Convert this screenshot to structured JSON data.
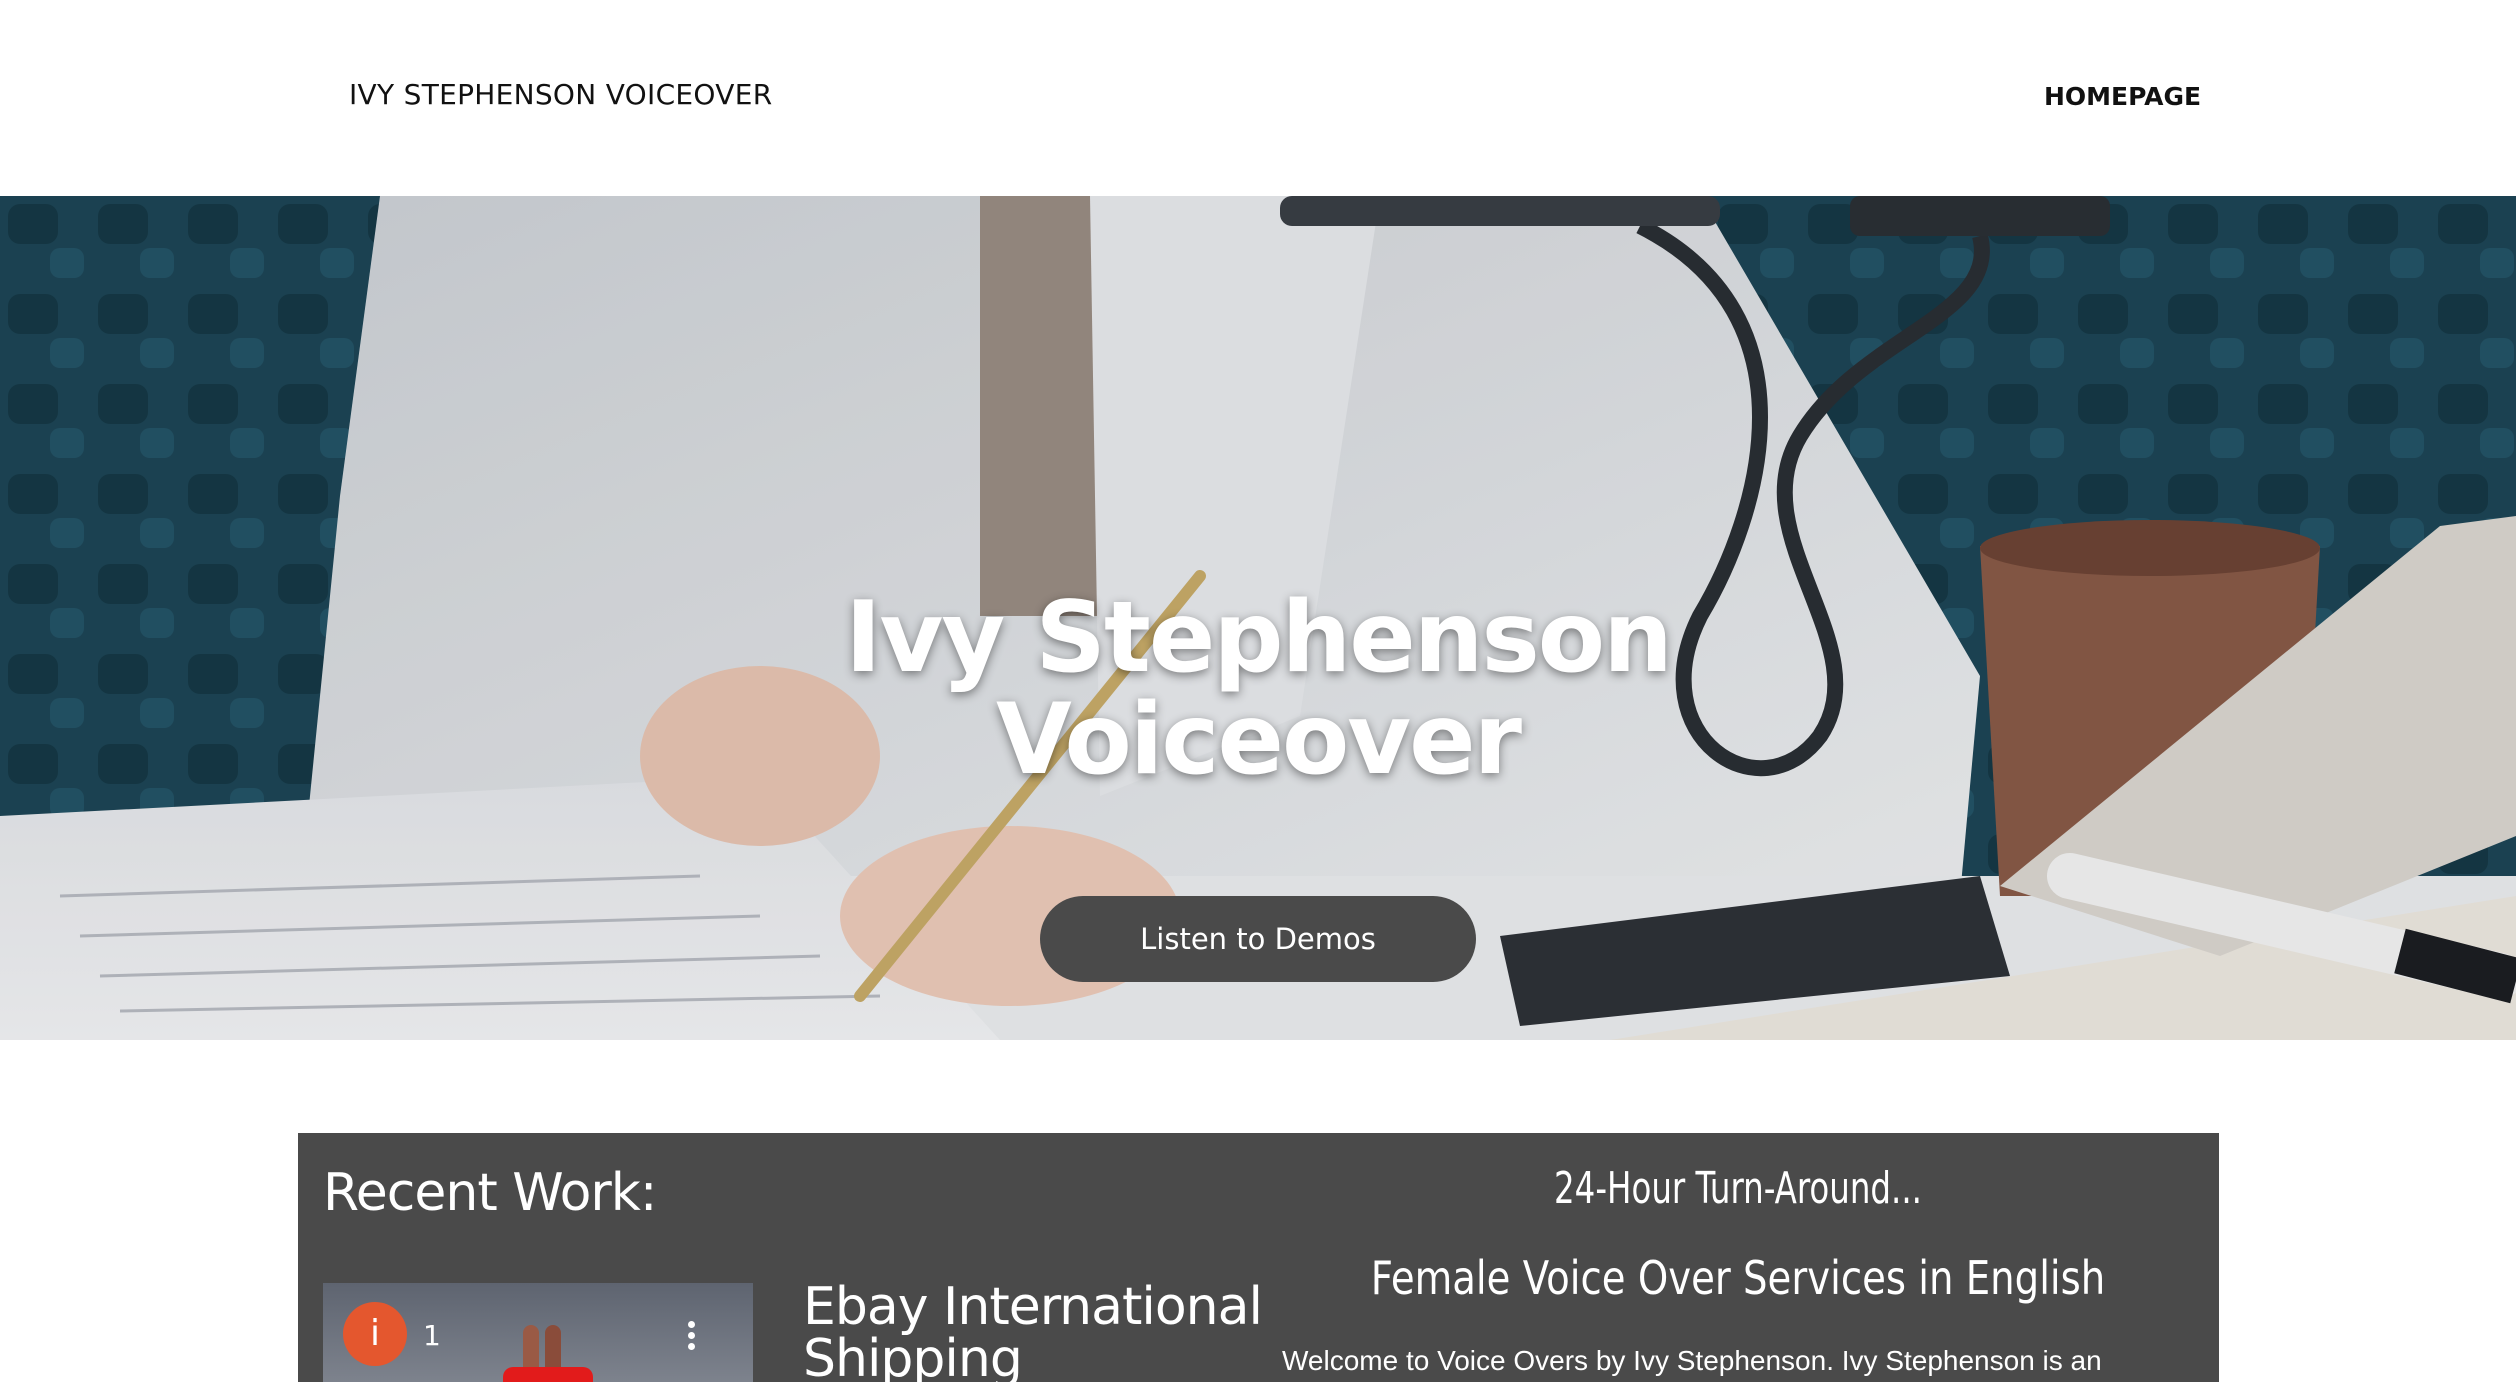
{
  "header": {
    "site_title": "IVY STEPHENSON VOICEOVER",
    "nav": {
      "home_label": "HOMEPAGE"
    }
  },
  "hero": {
    "title_line1": "Ivy Stephenson",
    "title_line2": "Voiceover",
    "cta_label": "Listen to Demos"
  },
  "recent_work": {
    "heading": "Recent Work:",
    "video": {
      "badge": "i",
      "count": "1",
      "title_line1": "Ebay International",
      "title_line2": "Shipping"
    }
  },
  "about": {
    "turnaround": "24-Hour Turn-Around...",
    "services": "Female Voice Over Services in English",
    "welcome": "Welcome to Voice Overs by Ivy Stephenson. Ivy Stephenson is an"
  },
  "colors": {
    "panel_bg": "#4a4a4a",
    "cta_bg": "#4a4a4a",
    "badge": "#e4572e"
  }
}
